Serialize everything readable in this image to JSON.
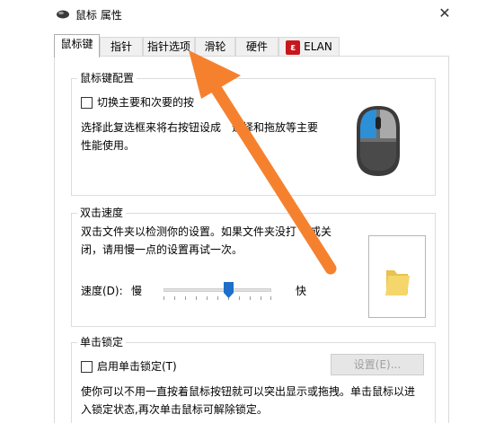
{
  "window": {
    "title": "鼠标 属性",
    "close_glyph": "✕"
  },
  "tabs": [
    {
      "label": "鼠标键",
      "active": true
    },
    {
      "label": "指针",
      "active": false
    },
    {
      "label": "指针选项",
      "active": false
    },
    {
      "label": "滑轮",
      "active": false
    },
    {
      "label": "硬件",
      "active": false
    },
    {
      "label": "ELAN",
      "active": false,
      "logo_glyph": "ε"
    }
  ],
  "button_config": {
    "legend": "鼠标键配置",
    "switch_checkbox": {
      "label": "切换主要和次要的按",
      "checked": false
    },
    "description_line1": "选择此复选框来将右按钮设成",
    "description_line1_tail": "选择和拖放等主要",
    "description_line2": "性能使用。"
  },
  "double_click": {
    "legend": "双击速度",
    "description_line1": "双击文件夹以检测你的设置。如果文件夹没打",
    "description_line1_tail": "或关",
    "description_line2": "闭，请用慢一点的设置再试一次。",
    "speed_label": "速度(D):",
    "slow_label": "慢",
    "fast_label": "快",
    "speed_value_fraction": 0.6
  },
  "click_lock": {
    "legend": "单击锁定",
    "checkbox": {
      "label": "启用单击锁定(T)",
      "checked": false
    },
    "settings_button": "设置(E)...",
    "description_line1": "使你可以不用一直按着鼠标按钮就可以突出显示或拖拽。单击鼠标以进",
    "description_line2": "入锁定状态,再次单击鼠标可解除锁定。"
  },
  "colors": {
    "mouse_accent": "#2d8fd6",
    "arrow": "#f5812f",
    "folder": "#f4d66b"
  },
  "icons": {
    "mouse": "mouse-icon",
    "folder": "folder-icon",
    "close": "close-icon",
    "annotation": "annotation-arrow"
  }
}
